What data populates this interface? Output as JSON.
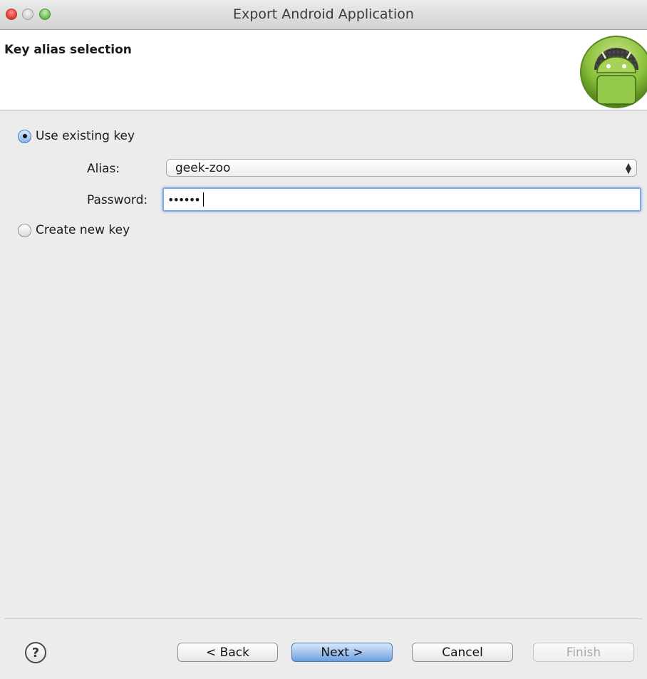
{
  "window": {
    "title": "Export Android Application"
  },
  "page": {
    "title": "Key alias selection"
  },
  "options": {
    "use_existing": {
      "label": "Use existing key",
      "selected": true
    },
    "create_new": {
      "label": "Create new key",
      "selected": false
    }
  },
  "form": {
    "alias_label": "Alias:",
    "alias_value": "geek-zoo",
    "password_label": "Password:",
    "password_masked": "••••••"
  },
  "footer": {
    "help_glyph": "?",
    "back_label": "< Back",
    "next_label": "Next >",
    "cancel_label": "Cancel",
    "finish_label": "Finish"
  },
  "icons": {
    "logo": "android-logo-icon",
    "help": "help-icon",
    "select": "updown-arrows-icon"
  },
  "colors": {
    "focus_ring": "#7aa8e0",
    "default_button": "#9ec1ec",
    "android_green": "#8ac03a"
  }
}
